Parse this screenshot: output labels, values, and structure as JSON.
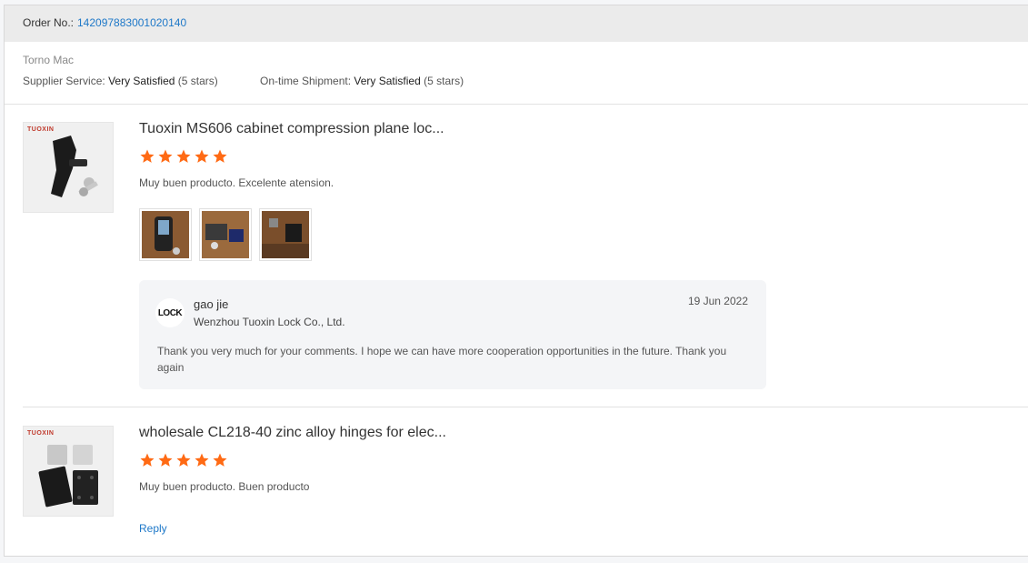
{
  "order": {
    "label": "Order No.:",
    "number": "142097883001020140"
  },
  "buyer": {
    "name": "Torno Mac",
    "supplier_service_label": "Supplier Service:",
    "supplier_service_value": "Very Satisfied",
    "supplier_service_stars": "(5 stars)",
    "shipment_label": "On-time Shipment:",
    "shipment_value": "Very Satisfied",
    "shipment_stars": "(5 stars)"
  },
  "products": [
    {
      "thumb_brand": "TUOXIN",
      "title": "Tuoxin MS606 cabinet compression plane loc...",
      "rating": 5,
      "comment": "Muy buen producto. Excelente atension.",
      "photos": 3,
      "reply": {
        "logo_text": "LOCK",
        "name": "gao jie",
        "company": "Wenzhou Tuoxin Lock Co., Ltd.",
        "date": "19 Jun 2022",
        "text": "Thank you very much for your comments.  I hope we can have more cooperation opportunities in the future. Thank you again"
      }
    },
    {
      "thumb_brand": "TUOXIN",
      "title": "wholesale CL218-40 zinc alloy hinges for elec...",
      "rating": 5,
      "comment": "Muy buen producto. Buen producto",
      "reply_link": "Reply"
    }
  ],
  "colors": {
    "link": "#1e78c8",
    "star": "#ff6a14",
    "header_bg": "#ebebeb",
    "reply_bg": "#f4f5f7"
  }
}
